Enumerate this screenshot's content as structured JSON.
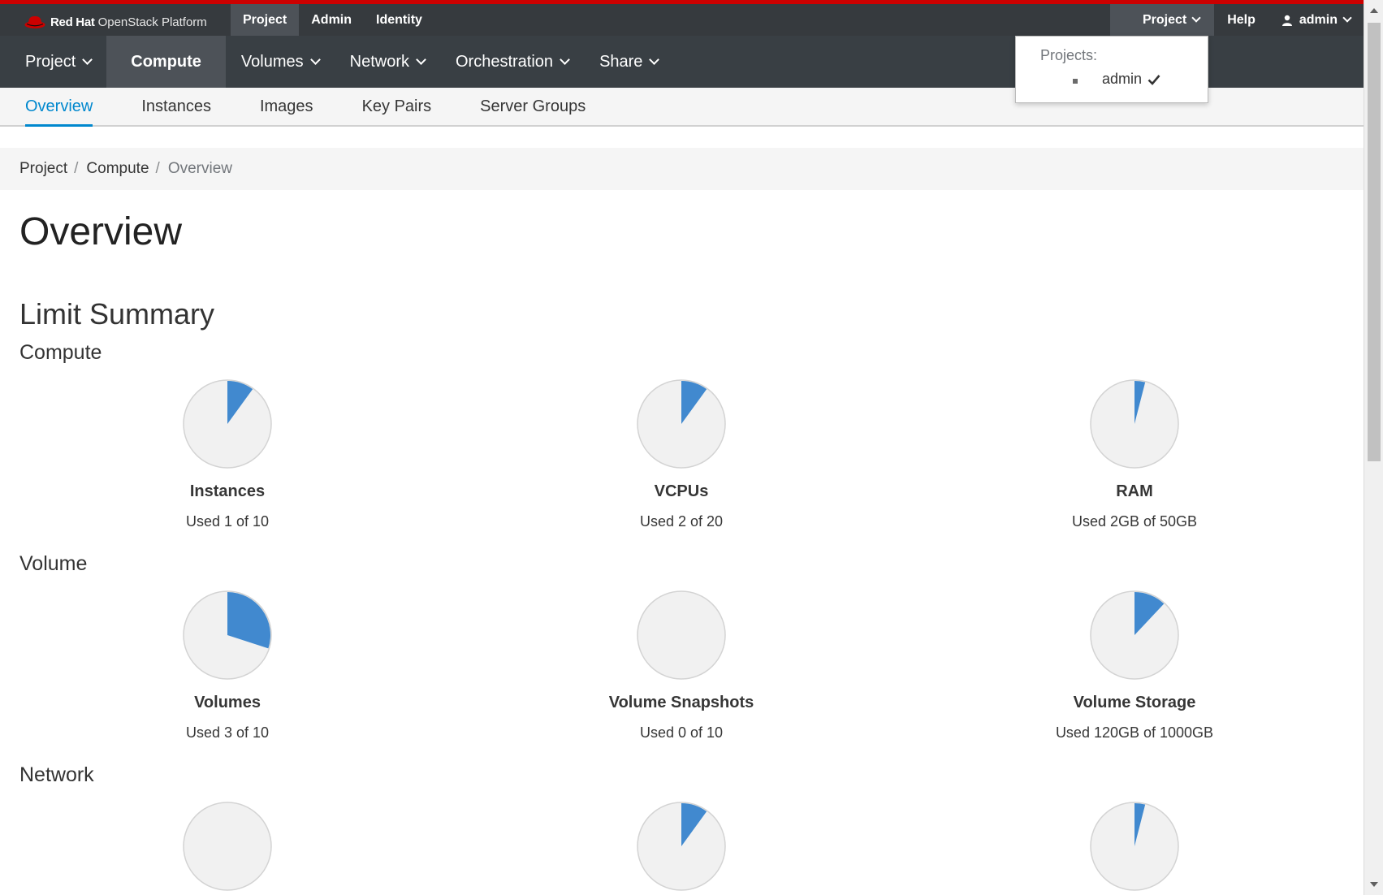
{
  "brand": {
    "name_bold": "Red Hat",
    "name_rest": "OpenStack Platform"
  },
  "top_tabs": [
    "Project",
    "Admin",
    "Identity"
  ],
  "top_right": {
    "project_menu": "Project",
    "help": "Help",
    "user": "admin"
  },
  "project_dropdown": {
    "header": "Projects:",
    "option": "admin"
  },
  "nav": [
    "Project",
    "Compute",
    "Volumes",
    "Network",
    "Orchestration",
    "Share"
  ],
  "subnav": [
    "Overview",
    "Instances",
    "Images",
    "Key Pairs",
    "Server Groups"
  ],
  "breadcrumb": {
    "items": [
      "Project",
      "Compute"
    ],
    "current": "Overview"
  },
  "page_title": "Overview",
  "limit_summary": "Limit Summary",
  "sections": {
    "compute": {
      "title": "Compute",
      "charts": [
        {
          "label": "Instances",
          "used_text": "Used 1 of 10",
          "fraction": 0.1
        },
        {
          "label": "VCPUs",
          "used_text": "Used 2 of 20",
          "fraction": 0.1
        },
        {
          "label": "RAM",
          "used_text": "Used 2GB of 50GB",
          "fraction": 0.04
        }
      ]
    },
    "volume": {
      "title": "Volume",
      "charts": [
        {
          "label": "Volumes",
          "used_text": "Used 3 of 10",
          "fraction": 0.3
        },
        {
          "label": "Volume Snapshots",
          "used_text": "Used 0 of 10",
          "fraction": 0
        },
        {
          "label": "Volume Storage",
          "used_text": "Used 120GB of 1000GB",
          "fraction": 0.12
        }
      ]
    },
    "network": {
      "title": "Network",
      "charts": [
        {
          "fraction": 0
        },
        {
          "fraction": 0.1
        },
        {
          "fraction": 0.04
        }
      ]
    }
  },
  "colors": {
    "used": "#4189cf",
    "free": "#f1f1f1",
    "pie_border": "#d3d3d3",
    "brand_red": "#cc0000",
    "link_blue": "#0088ce"
  }
}
